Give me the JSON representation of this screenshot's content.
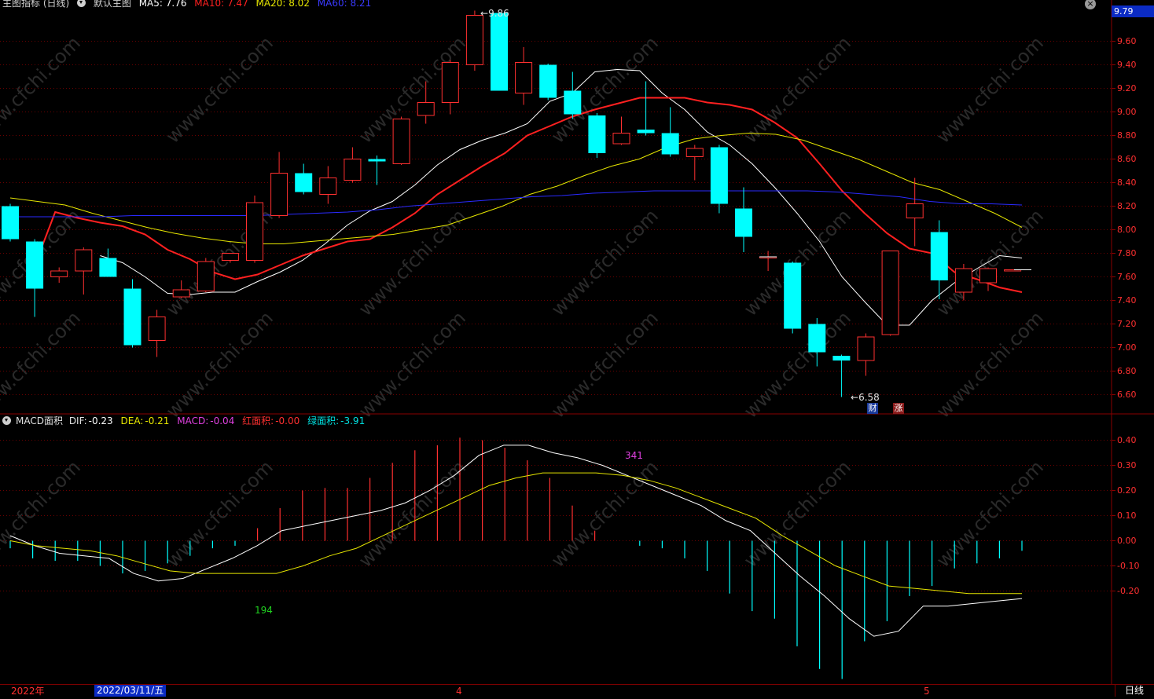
{
  "header": {
    "indicator_label": "主图指标 (日线)",
    "pattern_label": "默认主图",
    "ma5_label": "MA5: 7.76",
    "ma10_label": "MA10: 7.47",
    "ma20_label": "MA20: 8.02",
    "ma60_label": "MA60: 8.21",
    "colors": {
      "ma5": "#ffffff",
      "ma10": "#ff2020",
      "ma20": "#e6e600",
      "ma60": "#2a2aff"
    }
  },
  "current_price": "9.79",
  "macd_header": {
    "name": "MACD面积",
    "dif_label": "DIF:",
    "dif_value": "-0.23",
    "dea_label": "DEA:",
    "dea_value": "-0.21",
    "macd_label": "MACD:",
    "macd_value": "-0.04",
    "red_area_label": "红面积:",
    "red_area_value": "-0.00",
    "green_area_label": "绿面积:",
    "green_area_value": "-3.91"
  },
  "bottom_axis": {
    "year_label": "2022年",
    "cursor_date": "2022/03/11/五",
    "month_4": "4",
    "month_5": "5",
    "period": "日线"
  },
  "annotations": {
    "high_label": "9.86",
    "low_label": "6.58",
    "marker_cai": "财",
    "marker_zhang": "涨",
    "area_green": "194",
    "area_red": "341"
  },
  "watermark": "www.cfchi.com",
  "chart_data": [
    {
      "type": "candlestick",
      "title": "默认主图",
      "ylim": [
        6.45,
        9.9
      ],
      "yticks": [
        6.6,
        6.8,
        7.0,
        7.2,
        7.4,
        7.6,
        7.8,
        8.0,
        8.2,
        8.4,
        8.6,
        8.8,
        9.0,
        9.2,
        9.4,
        9.6
      ],
      "grid": true,
      "colors": {
        "up": "#ff3030",
        "down": "#00ffff"
      },
      "candles": [
        {
          "o": 8.2,
          "h": 8.22,
          "c": 7.92,
          "l": 7.9
        },
        {
          "o": 7.9,
          "h": 7.92,
          "c": 7.5,
          "l": 7.26
        },
        {
          "o": 7.6,
          "h": 7.68,
          "c": 7.65,
          "l": 7.55
        },
        {
          "o": 7.65,
          "h": 7.85,
          "c": 7.83,
          "l": 7.45
        },
        {
          "o": 7.76,
          "h": 7.84,
          "c": 7.6,
          "l": 7.6
        },
        {
          "o": 7.5,
          "h": 7.58,
          "c": 7.02,
          "l": 7.0
        },
        {
          "o": 7.06,
          "h": 7.32,
          "c": 7.26,
          "l": 6.92
        },
        {
          "o": 7.43,
          "h": 7.57,
          "c": 7.49,
          "l": 7.42
        },
        {
          "o": 7.48,
          "h": 7.76,
          "c": 7.73,
          "l": 7.47
        },
        {
          "o": 7.74,
          "h": 7.8,
          "c": 7.8,
          "l": 7.72
        },
        {
          "o": 7.74,
          "h": 8.29,
          "c": 8.23,
          "l": 7.72
        },
        {
          "o": 8.12,
          "h": 8.66,
          "c": 8.48,
          "l": 8.1
        },
        {
          "o": 8.48,
          "h": 8.56,
          "c": 8.32,
          "l": 8.3
        },
        {
          "o": 8.3,
          "h": 8.54,
          "c": 8.44,
          "l": 8.22
        },
        {
          "o": 8.42,
          "h": 8.7,
          "c": 8.6,
          "l": 8.4
        },
        {
          "o": 8.6,
          "h": 8.63,
          "c": 8.58,
          "l": 8.38
        },
        {
          "o": 8.56,
          "h": 8.96,
          "c": 8.94,
          "l": 8.55
        },
        {
          "o": 8.97,
          "h": 9.26,
          "c": 9.08,
          "l": 8.9
        },
        {
          "o": 9.08,
          "h": 9.44,
          "c": 9.42,
          "l": 8.98
        },
        {
          "o": 9.4,
          "h": 9.86,
          "c": 9.82,
          "l": 9.35
        },
        {
          "o": 9.84,
          "h": 9.85,
          "c": 9.18,
          "l": 9.18
        },
        {
          "o": 9.16,
          "h": 9.55,
          "c": 9.42,
          "l": 9.06
        },
        {
          "o": 9.4,
          "h": 9.41,
          "c": 9.12,
          "l": 9.1
        },
        {
          "o": 9.18,
          "h": 9.34,
          "c": 8.98,
          "l": 8.94
        },
        {
          "o": 8.97,
          "h": 8.99,
          "c": 8.65,
          "l": 8.61
        },
        {
          "o": 8.73,
          "h": 8.96,
          "c": 8.82,
          "l": 8.72
        },
        {
          "o": 8.85,
          "h": 9.26,
          "c": 8.82,
          "l": 8.8
        },
        {
          "o": 8.82,
          "h": 9.04,
          "c": 8.64,
          "l": 8.62
        },
        {
          "o": 8.62,
          "h": 8.72,
          "c": 8.69,
          "l": 8.42
        },
        {
          "o": 8.7,
          "h": 8.72,
          "c": 8.22,
          "l": 8.14
        },
        {
          "o": 8.18,
          "h": 8.36,
          "c": 7.94,
          "l": 7.81
        },
        {
          "o": 7.77,
          "h": 7.82,
          "c": 7.77,
          "l": 7.65
        },
        {
          "o": 7.72,
          "h": 7.73,
          "c": 7.16,
          "l": 7.12
        },
        {
          "o": 7.2,
          "h": 7.25,
          "c": 6.96,
          "l": 6.84
        },
        {
          "o": 6.93,
          "h": 6.94,
          "c": 6.89,
          "l": 6.58
        },
        {
          "o": 6.89,
          "h": 7.12,
          "c": 7.09,
          "l": 6.76
        },
        {
          "o": 7.11,
          "h": 7.82,
          "c": 7.82,
          "l": 7.1
        },
        {
          "o": 8.1,
          "h": 8.44,
          "c": 8.22,
          "l": 7.86
        },
        {
          "o": 7.98,
          "h": 8.08,
          "c": 7.57,
          "l": 7.41
        },
        {
          "o": 7.47,
          "h": 7.71,
          "c": 7.67,
          "l": 7.4
        },
        {
          "o": 7.55,
          "h": 7.68,
          "c": 7.67,
          "l": 7.48
        },
        {
          "o": 7.66,
          "h": 7.66,
          "c": 7.66,
          "l": 7.66
        }
      ],
      "series": [
        {
          "name": "MA5",
          "color": "#ffffff",
          "values": [
            null,
            null,
            null,
            null,
            7.78,
            7.72,
            7.6,
            7.46,
            7.45,
            7.47,
            7.47,
            7.56,
            7.64,
            7.74,
            7.88,
            8.04,
            8.16,
            8.24,
            8.38,
            8.55,
            8.68,
            8.76,
            8.82,
            8.9,
            9.09,
            9.16,
            9.34,
            9.36,
            9.35,
            9.16,
            9.02,
            8.83,
            8.72,
            8.56,
            8.36,
            8.14,
            7.9,
            7.6,
            7.39,
            7.19,
            7.19,
            7.4,
            7.55,
            7.67,
            7.78,
            7.76
          ]
        },
        {
          "name": "MA10",
          "color": "#ff2020",
          "values": [
            null,
            7.65,
            8.15,
            8.1,
            8.06,
            8.03,
            7.96,
            7.83,
            7.75,
            7.64,
            7.58,
            7.62,
            7.7,
            7.78,
            7.84,
            7.9,
            7.92,
            8.02,
            8.14,
            8.3,
            8.42,
            8.54,
            8.65,
            8.8,
            8.88,
            8.96,
            9.02,
            9.07,
            9.12,
            9.12,
            9.12,
            9.08,
            9.06,
            9.02,
            8.91,
            8.78,
            8.56,
            8.33,
            8.14,
            7.97,
            7.84,
            7.8,
            7.64,
            7.58,
            7.51,
            7.47
          ]
        },
        {
          "name": "MA20",
          "color": "#e6e600",
          "values": [
            8.27,
            8.24,
            8.21,
            8.14,
            8.08,
            8.02,
            7.97,
            7.93,
            7.9,
            7.88,
            7.88,
            7.9,
            7.92,
            7.94,
            7.96,
            8.0,
            8.04,
            8.12,
            8.2,
            8.3,
            8.37,
            8.46,
            8.54,
            8.6,
            8.7,
            8.77,
            8.8,
            8.82,
            8.81,
            8.76,
            8.68,
            8.6,
            8.5,
            8.4,
            8.34,
            8.24,
            8.14,
            8.02
          ]
        },
        {
          "name": "MA60",
          "color": "#2a2aff",
          "values": [
            8.11,
            8.11,
            8.11,
            8.11,
            8.12,
            8.12,
            8.12,
            8.12,
            8.12,
            8.13,
            8.14,
            8.15,
            8.17,
            8.2,
            8.22,
            8.24,
            8.26,
            8.28,
            8.29,
            8.31,
            8.32,
            8.33,
            8.33,
            8.33,
            8.33,
            8.33,
            8.33,
            8.32,
            8.3,
            8.28,
            8.24,
            8.22,
            8.22,
            8.21
          ]
        }
      ]
    },
    {
      "type": "bar",
      "title": "MACD面积",
      "ylim": [
        -0.52,
        0.44
      ],
      "yticks": [
        0.4,
        0.3,
        0.2,
        0.1,
        0.0,
        -0.1,
        -0.2
      ],
      "grid": true,
      "colors": {
        "positive": "#ff3030",
        "negative": "#00ffff"
      },
      "macd": [
        -0.03,
        -0.07,
        -0.08,
        -0.08,
        -0.1,
        -0.13,
        -0.12,
        -0.09,
        -0.06,
        -0.03,
        -0.02,
        0.05,
        0.13,
        0.2,
        0.21,
        0.21,
        0.25,
        0.31,
        0.36,
        0.38,
        0.41,
        0.4,
        0.37,
        0.32,
        0.25,
        0.14,
        0.04,
        0.0,
        -0.02,
        -0.03,
        -0.07,
        -0.12,
        -0.21,
        -0.28,
        -0.31,
        -0.42,
        -0.51,
        -0.55,
        -0.4,
        -0.32,
        -0.22,
        -0.18,
        -0.11,
        -0.09,
        -0.07,
        -0.04
      ],
      "series": [
        {
          "name": "DIF",
          "color": "#ffffff",
          "values": [
            0.02,
            -0.02,
            -0.05,
            -0.06,
            -0.07,
            -0.13,
            -0.16,
            -0.15,
            -0.11,
            -0.07,
            -0.02,
            0.04,
            0.06,
            0.08,
            0.1,
            0.12,
            0.15,
            0.2,
            0.26,
            0.34,
            0.38,
            0.38,
            0.35,
            0.33,
            0.3,
            0.26,
            0.22,
            0.18,
            0.14,
            0.08,
            0.04,
            -0.05,
            -0.14,
            -0.22,
            -0.31,
            -0.38,
            -0.36,
            -0.26,
            -0.26,
            -0.25,
            -0.24,
            -0.23
          ]
        },
        {
          "name": "DEA",
          "color": "#e6e600",
          "values": [
            0.0,
            -0.02,
            -0.03,
            -0.04,
            -0.06,
            -0.09,
            -0.12,
            -0.13,
            -0.13,
            -0.13,
            -0.13,
            -0.1,
            -0.06,
            -0.03,
            0.02,
            0.07,
            0.12,
            0.17,
            0.22,
            0.25,
            0.27,
            0.27,
            0.27,
            0.26,
            0.24,
            0.21,
            0.17,
            0.13,
            0.09,
            0.02,
            -0.04,
            -0.1,
            -0.14,
            -0.18,
            -0.19,
            -0.2,
            -0.21,
            -0.21,
            -0.21
          ]
        }
      ]
    }
  ]
}
